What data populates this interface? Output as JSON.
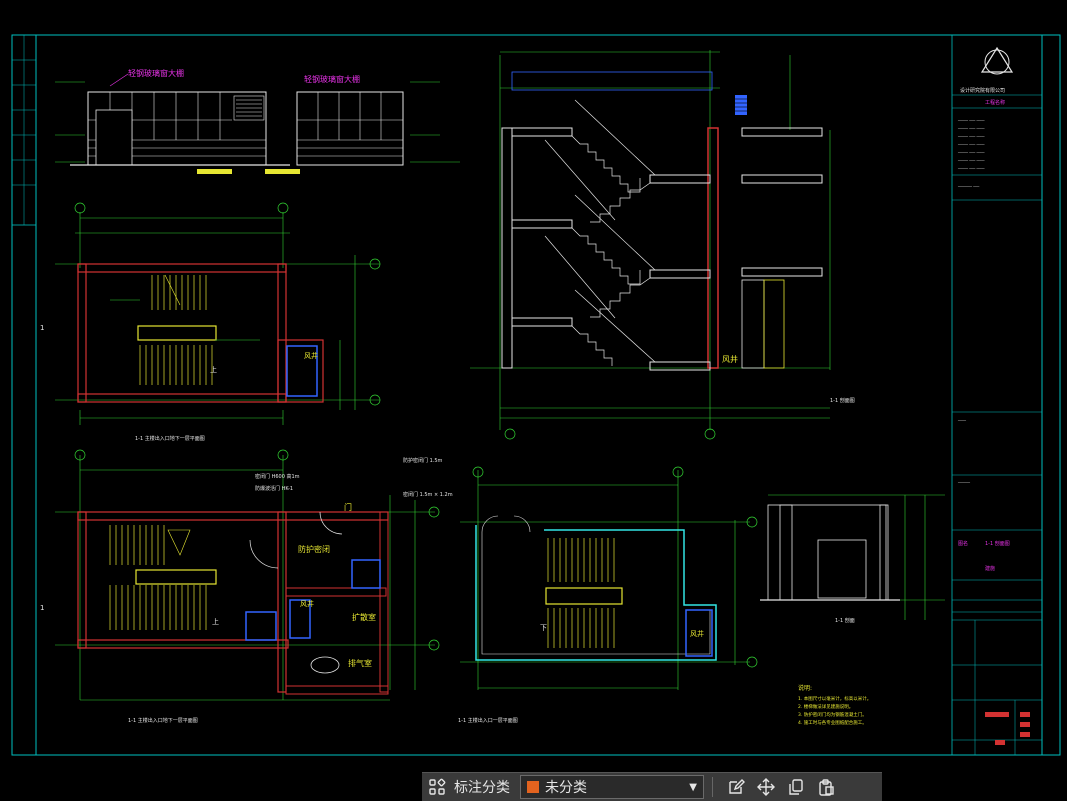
{
  "drawing": {
    "elev_titles": [
      "轻钢玻璃窗大棚",
      "轻钢玻璃窗大棚"
    ],
    "plan_titles": [
      "1-1 主楼出入口地下一层平面图",
      "1-1 主楼出入口地下一层平面图",
      "1-1 主楼出入口一层平面图",
      "1-1 剖面图",
      "1-1 剖面"
    ],
    "room_labels": {
      "fengjing": "风井",
      "kaijian": "防护密闭",
      "jiandu": "扩散室",
      "paiqi": "排气室",
      "door": "门",
      "up": "上",
      "down": "下"
    },
    "section_fengjing": "风井",
    "note_title": "说明:",
    "notes": [
      "1. 本图尺寸以毫米计，标高以米计。",
      "2. 楼梯做法详见建施说明。",
      "3. 防护密闭门均为钢筋混凝土门。",
      "4. 施工时与各专业图纸配合施工。"
    ],
    "callouts": [
      "密闭门 H600 高1m",
      "防爆波活门 HK-1",
      "防护密闭门 1.5m",
      "密闭门 1.5m × 1.2m"
    ],
    "axis_labels": [
      "A",
      "B",
      "C",
      "D",
      "1",
      "2",
      "3"
    ],
    "title_block": {
      "company": "设计研究院有限公司",
      "project_label": "工程名称",
      "drawing_label": "图名",
      "drawing_name": "1-1 剖面图",
      "sheet": "建施"
    },
    "colors": {
      "background": "#000000",
      "frame": "#00bfbf",
      "wall": "#d23232",
      "stair": "#e6e632",
      "dim": "#32d232",
      "text": "#e6e6e6",
      "blue": "#3264ff",
      "magenta": "#e632e6",
      "cyan": "#32e6e6"
    }
  },
  "toolbar": {
    "filter_icon": "layers-icon",
    "label": "标注分类",
    "select_value": "未分类",
    "select_color": "#e2631f",
    "tools": [
      "edit-icon",
      "move-icon",
      "copy-icon",
      "paste-icon"
    ]
  }
}
